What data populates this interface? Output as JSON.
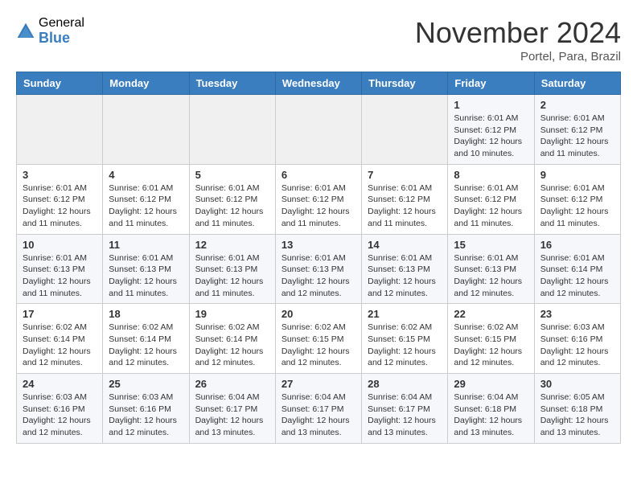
{
  "header": {
    "logo_general": "General",
    "logo_blue": "Blue",
    "month_title": "November 2024",
    "location": "Portel, Para, Brazil"
  },
  "days_of_week": [
    "Sunday",
    "Monday",
    "Tuesday",
    "Wednesday",
    "Thursday",
    "Friday",
    "Saturday"
  ],
  "weeks": [
    [
      {
        "day": "",
        "info": ""
      },
      {
        "day": "",
        "info": ""
      },
      {
        "day": "",
        "info": ""
      },
      {
        "day": "",
        "info": ""
      },
      {
        "day": "",
        "info": ""
      },
      {
        "day": "1",
        "info": "Sunrise: 6:01 AM\nSunset: 6:12 PM\nDaylight: 12 hours\nand 10 minutes."
      },
      {
        "day": "2",
        "info": "Sunrise: 6:01 AM\nSunset: 6:12 PM\nDaylight: 12 hours\nand 11 minutes."
      }
    ],
    [
      {
        "day": "3",
        "info": "Sunrise: 6:01 AM\nSunset: 6:12 PM\nDaylight: 12 hours\nand 11 minutes."
      },
      {
        "day": "4",
        "info": "Sunrise: 6:01 AM\nSunset: 6:12 PM\nDaylight: 12 hours\nand 11 minutes."
      },
      {
        "day": "5",
        "info": "Sunrise: 6:01 AM\nSunset: 6:12 PM\nDaylight: 12 hours\nand 11 minutes."
      },
      {
        "day": "6",
        "info": "Sunrise: 6:01 AM\nSunset: 6:12 PM\nDaylight: 12 hours\nand 11 minutes."
      },
      {
        "day": "7",
        "info": "Sunrise: 6:01 AM\nSunset: 6:12 PM\nDaylight: 12 hours\nand 11 minutes."
      },
      {
        "day": "8",
        "info": "Sunrise: 6:01 AM\nSunset: 6:12 PM\nDaylight: 12 hours\nand 11 minutes."
      },
      {
        "day": "9",
        "info": "Sunrise: 6:01 AM\nSunset: 6:12 PM\nDaylight: 12 hours\nand 11 minutes."
      }
    ],
    [
      {
        "day": "10",
        "info": "Sunrise: 6:01 AM\nSunset: 6:13 PM\nDaylight: 12 hours\nand 11 minutes."
      },
      {
        "day": "11",
        "info": "Sunrise: 6:01 AM\nSunset: 6:13 PM\nDaylight: 12 hours\nand 11 minutes."
      },
      {
        "day": "12",
        "info": "Sunrise: 6:01 AM\nSunset: 6:13 PM\nDaylight: 12 hours\nand 11 minutes."
      },
      {
        "day": "13",
        "info": "Sunrise: 6:01 AM\nSunset: 6:13 PM\nDaylight: 12 hours\nand 12 minutes."
      },
      {
        "day": "14",
        "info": "Sunrise: 6:01 AM\nSunset: 6:13 PM\nDaylight: 12 hours\nand 12 minutes."
      },
      {
        "day": "15",
        "info": "Sunrise: 6:01 AM\nSunset: 6:13 PM\nDaylight: 12 hours\nand 12 minutes."
      },
      {
        "day": "16",
        "info": "Sunrise: 6:01 AM\nSunset: 6:14 PM\nDaylight: 12 hours\nand 12 minutes."
      }
    ],
    [
      {
        "day": "17",
        "info": "Sunrise: 6:02 AM\nSunset: 6:14 PM\nDaylight: 12 hours\nand 12 minutes."
      },
      {
        "day": "18",
        "info": "Sunrise: 6:02 AM\nSunset: 6:14 PM\nDaylight: 12 hours\nand 12 minutes."
      },
      {
        "day": "19",
        "info": "Sunrise: 6:02 AM\nSunset: 6:14 PM\nDaylight: 12 hours\nand 12 minutes."
      },
      {
        "day": "20",
        "info": "Sunrise: 6:02 AM\nSunset: 6:15 PM\nDaylight: 12 hours\nand 12 minutes."
      },
      {
        "day": "21",
        "info": "Sunrise: 6:02 AM\nSunset: 6:15 PM\nDaylight: 12 hours\nand 12 minutes."
      },
      {
        "day": "22",
        "info": "Sunrise: 6:02 AM\nSunset: 6:15 PM\nDaylight: 12 hours\nand 12 minutes."
      },
      {
        "day": "23",
        "info": "Sunrise: 6:03 AM\nSunset: 6:16 PM\nDaylight: 12 hours\nand 12 minutes."
      }
    ],
    [
      {
        "day": "24",
        "info": "Sunrise: 6:03 AM\nSunset: 6:16 PM\nDaylight: 12 hours\nand 12 minutes."
      },
      {
        "day": "25",
        "info": "Sunrise: 6:03 AM\nSunset: 6:16 PM\nDaylight: 12 hours\nand 12 minutes."
      },
      {
        "day": "26",
        "info": "Sunrise: 6:04 AM\nSunset: 6:17 PM\nDaylight: 12 hours\nand 13 minutes."
      },
      {
        "day": "27",
        "info": "Sunrise: 6:04 AM\nSunset: 6:17 PM\nDaylight: 12 hours\nand 13 minutes."
      },
      {
        "day": "28",
        "info": "Sunrise: 6:04 AM\nSunset: 6:17 PM\nDaylight: 12 hours\nand 13 minutes."
      },
      {
        "day": "29",
        "info": "Sunrise: 6:04 AM\nSunset: 6:18 PM\nDaylight: 12 hours\nand 13 minutes."
      },
      {
        "day": "30",
        "info": "Sunrise: 6:05 AM\nSunset: 6:18 PM\nDaylight: 12 hours\nand 13 minutes."
      }
    ]
  ]
}
